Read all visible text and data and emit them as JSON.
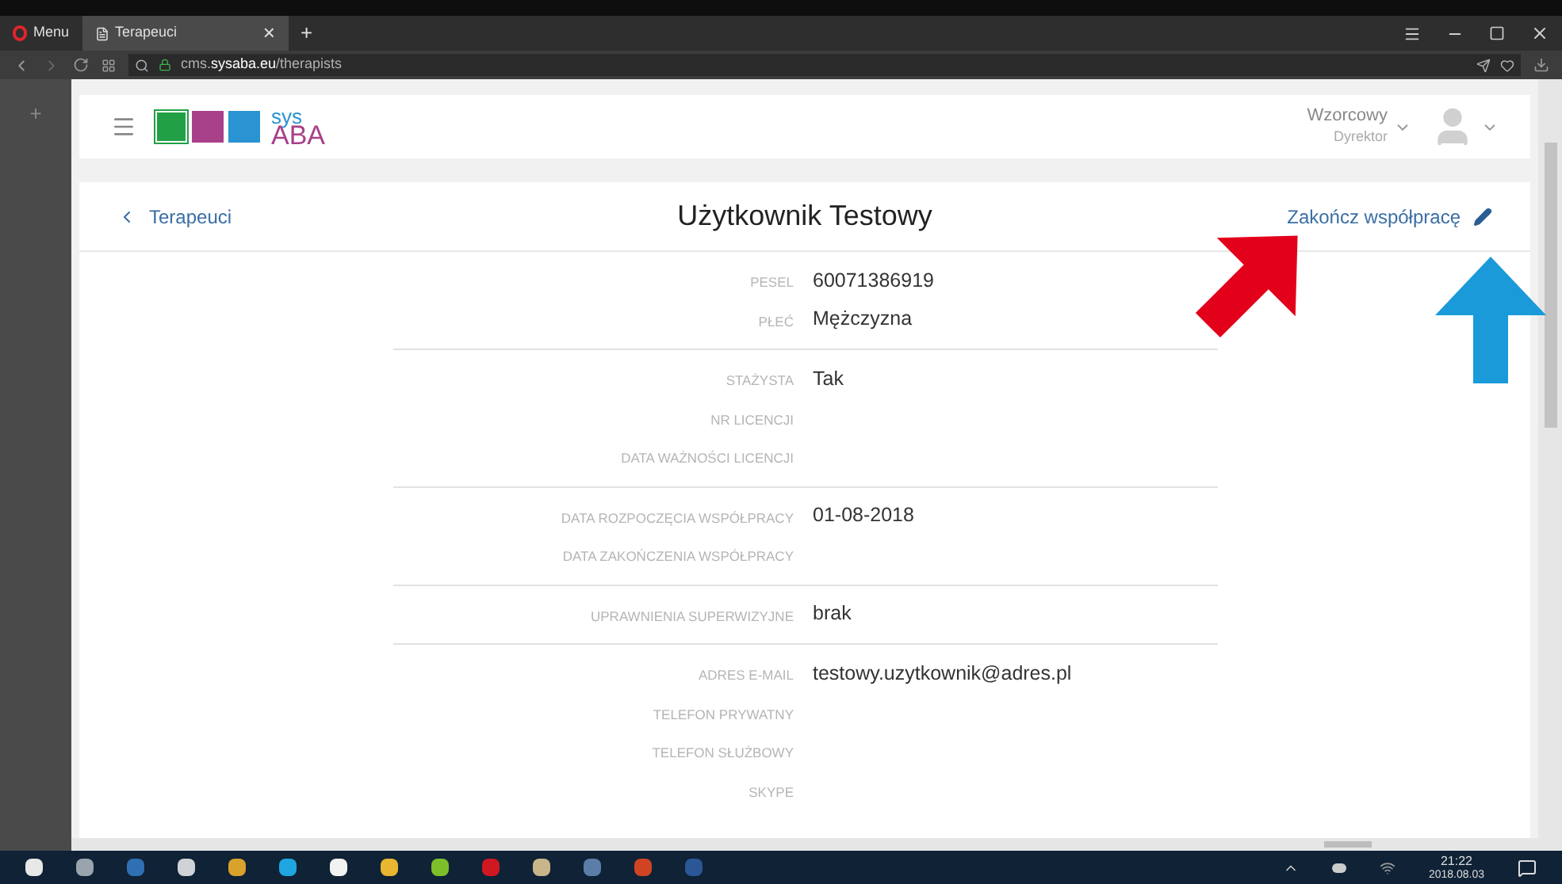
{
  "browser": {
    "menu": "Menu",
    "tab": {
      "title": "Terapeuci",
      "selected": true
    },
    "close_tab": "×",
    "new_tab": "+",
    "url_host": "cms.",
    "url_domain": "sysaba.eu",
    "url_path": "/therapists",
    "sidebar_add": "+"
  },
  "app": {
    "logo_top": "sys",
    "logo_bottom": "ABA",
    "user_name": "Wzorcowy",
    "user_role": "Dyrektor"
  },
  "card": {
    "back": "Terapeuci",
    "title": "Użytkownik Testowy",
    "action": "Zakończ współpracę"
  },
  "groups": [
    {
      "rows": [
        {
          "label": "PESEL",
          "value": "60071386919"
        },
        {
          "label": "PŁEĆ",
          "value": "Mężczyzna"
        }
      ]
    },
    {
      "rows": [
        {
          "label": "STAŻYSTA",
          "value": "Tak"
        },
        {
          "label": "NR LICENCJI"
        },
        {
          "label": "DATA WAŻNOŚCI LICENCJI"
        }
      ]
    },
    {
      "rows": [
        {
          "label": "DATA ROZPOCZĘCIA WSPÓŁPRACY",
          "value": "01-08-2018"
        },
        {
          "label": "DATA ZAKOŃCZENIA WSPÓŁPRACY"
        }
      ]
    },
    {
      "rows": [
        {
          "label": "UPRAWNIENIA SUPERWIZYJNE",
          "value": "brak"
        }
      ]
    },
    {
      "rows": [
        {
          "label": "ADRES E-MAIL",
          "value": "testowy.uzytkownik@adres.pl"
        },
        {
          "label": "TELEFON PRYWATNY"
        },
        {
          "label": "TELEFON SŁUŻBOWY"
        },
        {
          "label": "SKYPE"
        }
      ]
    }
  ],
  "taskbar": {
    "time": "21:22",
    "date": "2018.08.03"
  }
}
